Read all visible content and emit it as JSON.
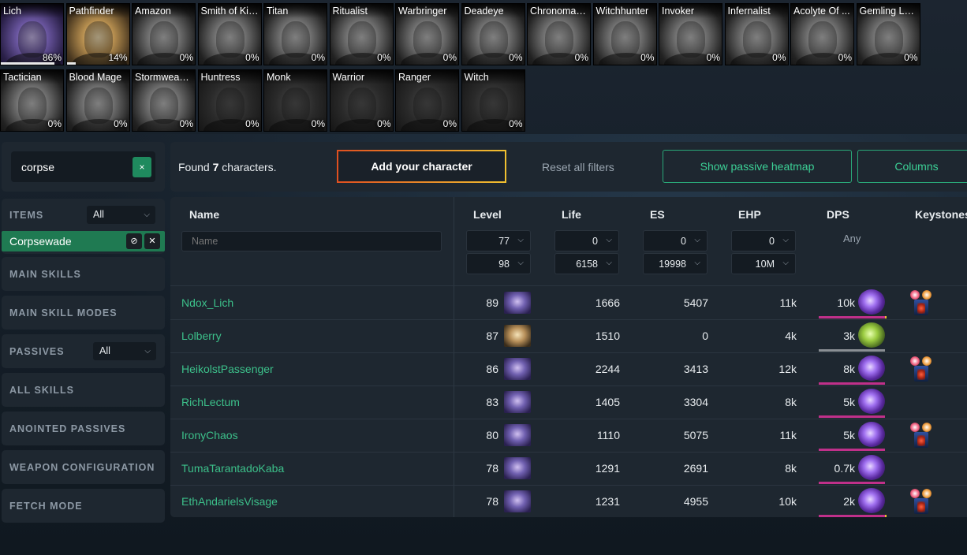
{
  "classes": [
    {
      "name": "Lich",
      "pct": "86%",
      "style": "sel-lich",
      "progress": 0.86
    },
    {
      "name": "Pathfinder",
      "pct": "14%",
      "style": "sel-pf",
      "progress": 0.14
    },
    {
      "name": "Amazon",
      "pct": "0%",
      "style": "lit",
      "progress": 0
    },
    {
      "name": "Smith of Kit...",
      "pct": "0%",
      "style": "lit",
      "progress": 0
    },
    {
      "name": "Titan",
      "pct": "0%",
      "style": "lit",
      "progress": 0
    },
    {
      "name": "Ritualist",
      "pct": "0%",
      "style": "lit",
      "progress": 0
    },
    {
      "name": "Warbringer",
      "pct": "0%",
      "style": "lit",
      "progress": 0
    },
    {
      "name": "Deadeye",
      "pct": "0%",
      "style": "lit",
      "progress": 0
    },
    {
      "name": "Chronoman...",
      "pct": "0%",
      "style": "lit",
      "progress": 0
    },
    {
      "name": "Witchhunter",
      "pct": "0%",
      "style": "lit",
      "progress": 0
    },
    {
      "name": "Invoker",
      "pct": "0%",
      "style": "lit",
      "progress": 0
    },
    {
      "name": "Infernalist",
      "pct": "0%",
      "style": "lit",
      "progress": 0
    },
    {
      "name": "Acolyte Of ...",
      "pct": "0%",
      "style": "lit",
      "progress": 0
    },
    {
      "name": "Gemling Le...",
      "pct": "0%",
      "style": "lit",
      "progress": 0
    },
    {
      "name": "Tactician",
      "pct": "0%",
      "style": "lit",
      "progress": 0
    },
    {
      "name": "Blood Mage",
      "pct": "0%",
      "style": "lit",
      "progress": 0
    },
    {
      "name": "Stormweaver",
      "pct": "0%",
      "style": "lit",
      "progress": 0
    },
    {
      "name": "Huntress",
      "pct": "0%",
      "style": "dim",
      "progress": 0
    },
    {
      "name": "Monk",
      "pct": "0%",
      "style": "dim",
      "progress": 0
    },
    {
      "name": "Warrior",
      "pct": "0%",
      "style": "dim",
      "progress": 0
    },
    {
      "name": "Ranger",
      "pct": "0%",
      "style": "dim",
      "progress": 0
    },
    {
      "name": "Witch",
      "pct": "0%",
      "style": "dim",
      "progress": 0
    }
  ],
  "search": {
    "value": "corpse",
    "clear": "×"
  },
  "filters": {
    "items": {
      "label": "ITEMS",
      "value": "All",
      "tag": "Corpsewade"
    },
    "main_skills": "MAIN SKILLS",
    "main_skill_modes": "MAIN SKILL MODES",
    "passives": {
      "label": "PASSIVES",
      "value": "All"
    },
    "all_skills": "ALL SKILLS",
    "anointed": "ANOINTED PASSIVES",
    "weapon": "WEAPON CONFIGURATION",
    "fetch": "FETCH MODE"
  },
  "toolbar": {
    "found_prefix": "Found ",
    "found_count": "7",
    "found_suffix": " characters.",
    "add": "Add your character",
    "reset": "Reset all filters",
    "heatmap": "Show passive heatmap",
    "columns": "Columns"
  },
  "table": {
    "headers": {
      "name": "Name",
      "level": "Level",
      "life": "Life",
      "es": "ES",
      "ehp": "EHP",
      "dps": "DPS",
      "keystones": "Keystones"
    },
    "name_placeholder": "Name",
    "filters": {
      "level_min": "77",
      "level_max": "98",
      "life_min": "0",
      "life_max": "6158",
      "es_min": "0",
      "es_max": "19998",
      "ehp_min": "0",
      "ehp_max": "10M",
      "dps": "Any"
    },
    "rows": [
      {
        "name": "Ndox_Lich",
        "level": "89",
        "class": "lich",
        "life": "1666",
        "es": "5407",
        "ehp": "11k",
        "dps": "10k",
        "skill": "purple",
        "bar": "mag",
        "tip": true,
        "keystone": true
      },
      {
        "name": "Lolberry",
        "level": "87",
        "class": "pf",
        "life": "1510",
        "es": "0",
        "ehp": "4k",
        "dps": "3k",
        "skill": "green",
        "bar": "gray",
        "tip": false,
        "keystone": false
      },
      {
        "name": "HeikolstPassenger",
        "level": "86",
        "class": "lich",
        "life": "2244",
        "es": "3413",
        "ehp": "12k",
        "dps": "8k",
        "skill": "purple",
        "bar": "mag",
        "tip": false,
        "keystone": true
      },
      {
        "name": "RichLectum",
        "level": "83",
        "class": "lich",
        "life": "1405",
        "es": "3304",
        "ehp": "8k",
        "dps": "5k",
        "skill": "purple",
        "bar": "mag",
        "tip": false,
        "keystone": false
      },
      {
        "name": "IronyChaos",
        "level": "80",
        "class": "lich",
        "life": "1110",
        "es": "5075",
        "ehp": "11k",
        "dps": "5k",
        "skill": "purple",
        "bar": "mag",
        "tip": false,
        "keystone": true
      },
      {
        "name": "TumaTarantadoKaba",
        "level": "78",
        "class": "lich",
        "life": "1291",
        "es": "2691",
        "ehp": "8k",
        "dps": "0.7k",
        "skill": "purple",
        "bar": "mag",
        "tip": false,
        "keystone": false
      },
      {
        "name": "EthAndarielsVisage",
        "level": "78",
        "class": "lich",
        "life": "1231",
        "es": "4955",
        "ehp": "10k",
        "dps": "2k",
        "skill": "purple",
        "bar": "mag",
        "tip": true,
        "keystone": true
      }
    ]
  },
  "colors": {
    "accent_green": "#3cc08a",
    "tag_green": "#1f7a52",
    "dps_bar": "#c0308a"
  }
}
